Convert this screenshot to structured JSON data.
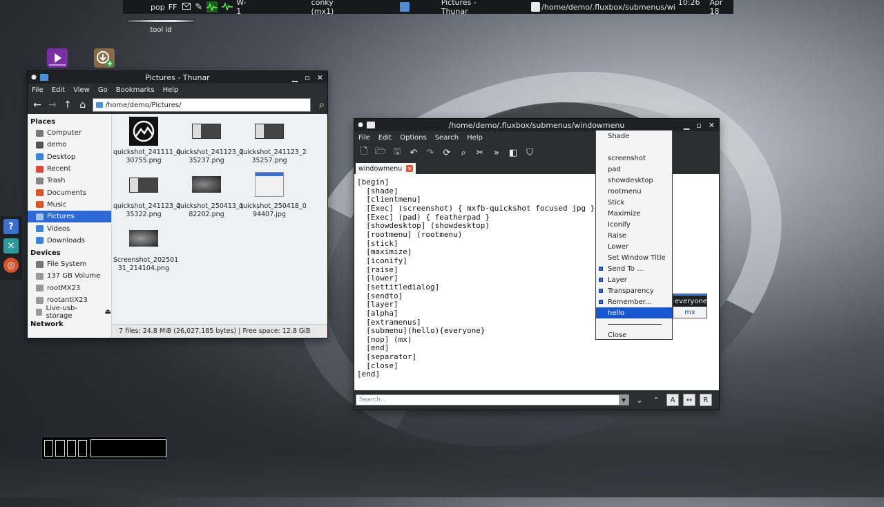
{
  "topbar": {
    "pop_label": "pop",
    "ff_label": "FF",
    "workspace": "W-1",
    "conky_task": "conky (mx1)",
    "thunar_task": "Pictures - Thunar",
    "fpad_task": "/home/demo/.fluxbox/submenus/wi",
    "time": "10:26",
    "date": "Apr 18"
  },
  "desktop": {
    "toolid_label": "tool id"
  },
  "thunar": {
    "title": "Pictures - Thunar",
    "menu": [
      "File",
      "Edit",
      "View",
      "Go",
      "Bookmarks",
      "Help"
    ],
    "address": "/home/demo/Pictures/",
    "sections": {
      "places": "Places",
      "devices": "Devices",
      "network": "Network"
    },
    "places": [
      "Computer",
      "demo",
      "Desktop",
      "Recent",
      "Trash",
      "Documents",
      "Music",
      "Pictures",
      "Videos",
      "Downloads"
    ],
    "devices": [
      "File System",
      "137 GB Volume",
      "rootMX23",
      "rootantiX23",
      "Live-usb-storage"
    ],
    "files": [
      {
        "line1": "quickshot_241111_0",
        "line2": "30755.png"
      },
      {
        "line1": "quickshot_241123_2",
        "line2": "35237.png"
      },
      {
        "line1": "quickshot_241123_2",
        "line2": "35257.png"
      },
      {
        "line1": "quickshot_241123_2",
        "line2": "35322.png"
      },
      {
        "line1": "quickshot_250413_1",
        "line2": "82202.png"
      },
      {
        "line1": "quickshot_250418_0",
        "line2": "94407.jpg"
      },
      {
        "line1": "Screenshot_202501",
        "line2": "31_214104.png"
      }
    ],
    "status": "7 files: 24.8 MiB (26,027,185 bytes)  |  Free space: 12.8 GiB"
  },
  "featherpad": {
    "title": "/home/demo/.fluxbox/submenus/windowmenu",
    "menu": [
      "File",
      "Edit",
      "Options",
      "Search",
      "Help"
    ],
    "tab": "windowmenu",
    "lines": [
      "[begin]",
      "  [shade]",
      "  [clientmenu]",
      "  [Exec] (screenshot) { mxfb-quickshot focused jpg }",
      "  [Exec] (pad) { featherpad }",
      "  [showdesktop] (showdesktop)",
      "  [rootmenu] (rootmenu)",
      "  [stick]",
      "  [maximize]",
      "  [iconify]",
      "  [raise]",
      "  [lower]",
      "  [settitledialog]",
      "  [sendto]",
      "  [layer]",
      "  [alpha]",
      "  [extramenus]",
      "  [submenu](hello){everyone}",
      "  [nop] (mx)",
      "  [end]",
      "  [separator]",
      "  [close]",
      "[end]"
    ],
    "search_placeholder": "Search..."
  },
  "context_menu": {
    "items": [
      "Shade",
      "screenshot",
      "pad",
      "showdesktop",
      "rootmenu",
      "Stick",
      "Maximize",
      "Iconify",
      "Raise",
      "Lower",
      "Set Window Title",
      "Send To ...",
      "Layer",
      "Transparency",
      "Remember...",
      "hello",
      "Close"
    ],
    "selected": "hello"
  },
  "submenu": {
    "title": "everyone",
    "item": "mx"
  }
}
